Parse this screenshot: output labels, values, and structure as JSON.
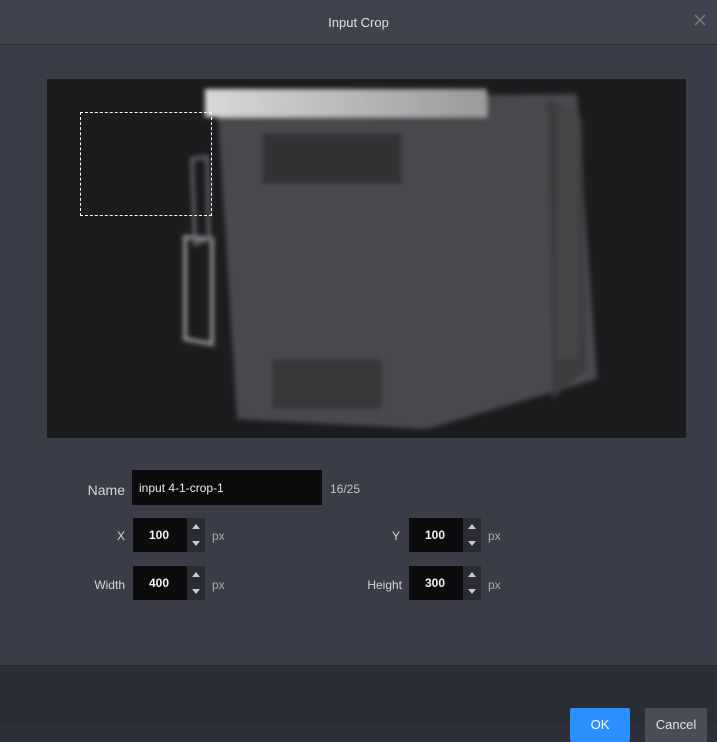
{
  "dialog": {
    "title": "Input Crop"
  },
  "form": {
    "name_label": "Name",
    "name_value": "input 4-1-crop-1",
    "name_count": "16/25",
    "x_label": "X",
    "x_value": "100",
    "y_label": "Y",
    "y_value": "100",
    "width_label": "Width",
    "width_value": "400",
    "height_label": "Height",
    "height_value": "300",
    "unit": "px"
  },
  "buttons": {
    "ok": "OK",
    "cancel": "Cancel"
  },
  "colors": {
    "accent": "#2c8fff",
    "dialog_bg": "#3a3c47",
    "input_bg": "#0c0c0e"
  }
}
